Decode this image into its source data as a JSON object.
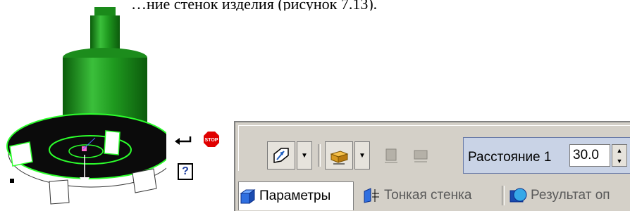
{
  "caption": "…ние стенок изделия (рисунок 7.13).",
  "model": {
    "accent": "#1fa21f",
    "edge_highlight": "#2cff2c"
  },
  "side_buttons": {
    "confirm_icon": "enter-arrow-icon",
    "stop_label": "STOP",
    "help_label": "?"
  },
  "toolbar": {
    "direction_icon": "direction-icon",
    "mode_icon": "thickness-mode-icon",
    "param_label": "Расстояние 1",
    "param_value": "30.0"
  },
  "tabs": [
    {
      "label": "Параметры",
      "active": true
    },
    {
      "label": "Тонкая стенка",
      "active": false
    },
    {
      "label": "Результат оп",
      "active": false
    }
  ]
}
